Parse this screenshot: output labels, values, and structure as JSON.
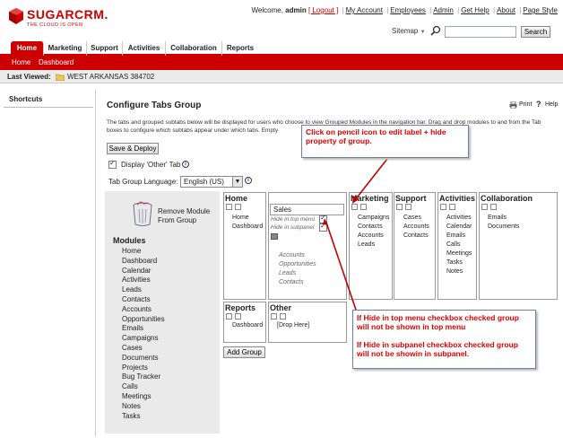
{
  "brand": {
    "name": "SUGARCRM.",
    "tagline": "THE CLOUD IS OPEN"
  },
  "header": {
    "welcome_prefix": "Welcome,",
    "user": "admin",
    "logout": "[ Logout ]",
    "links": [
      "My Account",
      "Employees",
      "Admin",
      "Get Help",
      "About",
      "Page Style"
    ],
    "sitemap": "Sitemap",
    "search_value": "",
    "search_button": "Search"
  },
  "tabs": [
    "Home",
    "Marketing",
    "Support",
    "Activities",
    "Collaboration",
    "Reports"
  ],
  "subtabs": [
    "Home",
    "Dashboard"
  ],
  "last_viewed": {
    "label": "Last Viewed:",
    "item": "WEST ARKANSAS 384702"
  },
  "sidebar": {
    "title": "Shortcuts"
  },
  "page": {
    "title": "Configure Tabs Group",
    "print": "Print",
    "help": "Help",
    "description": "The tabs and grouped subtabs below will be displayed for users who choose to view Grouped Modules in the navigation bar. Drag and drop modules to and from the Tab boxes to configure which subtabs appear under which tabs. Empty",
    "save_button": "Save & Deploy",
    "display_other_label": "Display 'Other' Tab",
    "lang_label": "Tab Group Language:",
    "lang_value": "English (US)",
    "add_group": "Add Group"
  },
  "modules_panel": {
    "remove_label_1": "Remove Module",
    "remove_label_2": "From Group",
    "title": "Modules",
    "items": [
      "Home",
      "Dashboard",
      "Calendar",
      "Activities",
      "Leads",
      "Contacts",
      "Accounts",
      "Opportunities",
      "Emails",
      "Campaigns",
      "Cases",
      "Documents",
      "Projects",
      "Bug Tracker",
      "Calls",
      "Meetings",
      "Notes",
      "Tasks"
    ]
  },
  "groups": {
    "home": {
      "title": "Home",
      "items": [
        "Home",
        "Dashboard"
      ]
    },
    "sales": {
      "value": "Sales",
      "hide_top": "Hide in top menu",
      "hide_subpanel": "Hide in subpanel",
      "items": [
        "Accounts",
        "Opportunities",
        "Leads",
        "Contacts"
      ]
    },
    "marketing": {
      "title": "Marketing",
      "items": [
        "Campaigns",
        "Contacts",
        "Accounts",
        "Leads"
      ]
    },
    "support": {
      "title": "Support",
      "items": [
        "Cases",
        "Accounts",
        "Contacts"
      ]
    },
    "activities": {
      "title": "Activities",
      "items": [
        "Activities",
        "Calendar",
        "Emails",
        "Calls",
        "Meetings",
        "Tasks",
        "Notes"
      ]
    },
    "collaboration": {
      "title": "Collaboration",
      "items": [
        "Emails",
        "Documents"
      ]
    },
    "reports": {
      "title": "Reports",
      "items": [
        "Dashboard"
      ]
    },
    "other": {
      "title": "Other",
      "items": [
        "[Drop Here]"
      ]
    }
  },
  "callouts": {
    "pencil": "Click on pencil icon to edit label + hide property of group.",
    "hide_top": "If Hide in top menu checkbox checked group will not be shown in top menu",
    "hide_sub": "If Hide in subpanel checkbox checked group will not be showin in subpanel."
  },
  "colors": {
    "brand_red": "#cc0000",
    "callout_border": "#6b7fa8",
    "arrow": "#c00000"
  }
}
